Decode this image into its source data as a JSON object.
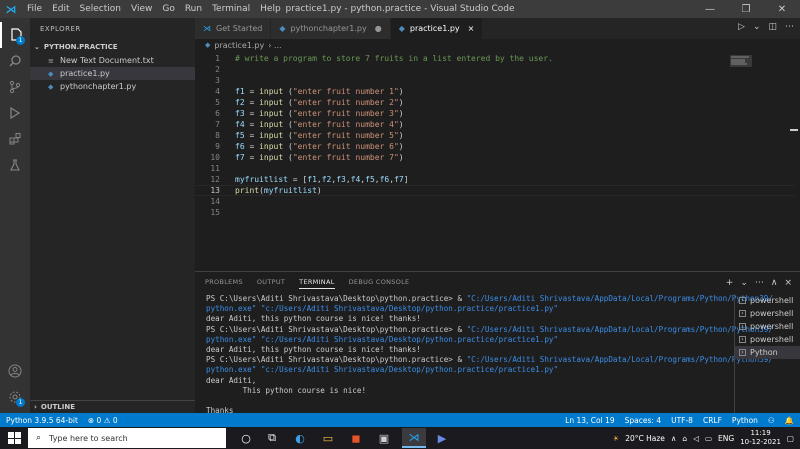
{
  "window": {
    "title": "practice1.py - python.practice - Visual Studio Code",
    "menu": [
      "File",
      "Edit",
      "Selection",
      "View",
      "Go",
      "Run",
      "Terminal",
      "Help"
    ]
  },
  "activity_bar": {
    "explorer_badge": "1",
    "accounts_badge": "1"
  },
  "sidebar": {
    "header": "EXPLORER",
    "folder": "PYTHON.PRACTICE",
    "files": [
      "New Text Document.txt",
      "practice1.py",
      "pythonchapter1.py"
    ],
    "outline": "OUTLINE"
  },
  "tabs": [
    {
      "label": "Get Started"
    },
    {
      "label": "pythonchapter1.py",
      "marker": "●"
    },
    {
      "label": "practice1.py",
      "marker": "×"
    }
  ],
  "breadcrumb": {
    "file": "practice1.py",
    "rest": "› ..."
  },
  "editor": {
    "current_line": 13,
    "lines": [
      [
        {
          "t": "# write a program to store 7 fruits in a list entered by the user.",
          "c": "comment"
        }
      ],
      [],
      [],
      [
        {
          "t": "f1",
          "c": "var"
        },
        {
          "t": " = ",
          "c": "op"
        },
        {
          "t": "input",
          "c": "fn"
        },
        {
          "t": " (",
          "c": "op"
        },
        {
          "t": "\"enter fruit number 1\"",
          "c": "str"
        },
        {
          "t": ")",
          "c": "op"
        }
      ],
      [
        {
          "t": "f2",
          "c": "var"
        },
        {
          "t": " = ",
          "c": "op"
        },
        {
          "t": "input",
          "c": "fn"
        },
        {
          "t": " (",
          "c": "op"
        },
        {
          "t": "\"enter fruit number 2\"",
          "c": "str"
        },
        {
          "t": ")",
          "c": "op"
        }
      ],
      [
        {
          "t": "f3",
          "c": "var"
        },
        {
          "t": " = ",
          "c": "op"
        },
        {
          "t": "input",
          "c": "fn"
        },
        {
          "t": " (",
          "c": "op"
        },
        {
          "t": "\"enter fruit number 3\"",
          "c": "str"
        },
        {
          "t": ")",
          "c": "op"
        }
      ],
      [
        {
          "t": "f4",
          "c": "var"
        },
        {
          "t": " = ",
          "c": "op"
        },
        {
          "t": "input",
          "c": "fn"
        },
        {
          "t": " (",
          "c": "op"
        },
        {
          "t": "\"enter fruit number 4\"",
          "c": "str"
        },
        {
          "t": ")",
          "c": "op"
        }
      ],
      [
        {
          "t": "f5",
          "c": "var"
        },
        {
          "t": " = ",
          "c": "op"
        },
        {
          "t": "input",
          "c": "fn"
        },
        {
          "t": " (",
          "c": "op"
        },
        {
          "t": "\"enter fruit number 5\"",
          "c": "str"
        },
        {
          "t": ")",
          "c": "op"
        }
      ],
      [
        {
          "t": "f6",
          "c": "var"
        },
        {
          "t": " = ",
          "c": "op"
        },
        {
          "t": "input",
          "c": "fn"
        },
        {
          "t": " (",
          "c": "op"
        },
        {
          "t": "\"enter fruit number 6\"",
          "c": "str"
        },
        {
          "t": ")",
          "c": "op"
        }
      ],
      [
        {
          "t": "f7",
          "c": "var"
        },
        {
          "t": " = ",
          "c": "op"
        },
        {
          "t": "input",
          "c": "fn"
        },
        {
          "t": " (",
          "c": "op"
        },
        {
          "t": "\"enter fruit number 7\"",
          "c": "str"
        },
        {
          "t": ")",
          "c": "op"
        }
      ],
      [],
      [
        {
          "t": "myfruitlist",
          "c": "var"
        },
        {
          "t": " = [",
          "c": "op"
        },
        {
          "t": "f1",
          "c": "var"
        },
        {
          "t": ",",
          "c": "op"
        },
        {
          "t": "f2",
          "c": "var"
        },
        {
          "t": ",",
          "c": "op"
        },
        {
          "t": "f3",
          "c": "var"
        },
        {
          "t": ",",
          "c": "op"
        },
        {
          "t": "f4",
          "c": "var"
        },
        {
          "t": ",",
          "c": "op"
        },
        {
          "t": "f5",
          "c": "var"
        },
        {
          "t": ",",
          "c": "op"
        },
        {
          "t": "f6",
          "c": "var"
        },
        {
          "t": ",",
          "c": "op"
        },
        {
          "t": "f7",
          "c": "var"
        },
        {
          "t": "]",
          "c": "op"
        }
      ],
      [
        {
          "t": "print",
          "c": "fn"
        },
        {
          "t": "(",
          "c": "op"
        },
        {
          "t": "myfruitlist",
          "c": "var"
        },
        {
          "t": ")",
          "c": "op"
        }
      ],
      [],
      []
    ]
  },
  "panel": {
    "tabs": [
      "PROBLEMS",
      "OUTPUT",
      "TERMINAL",
      "DEBUG CONSOLE"
    ],
    "active_tab": "TERMINAL",
    "tools": [
      "+",
      "⌄",
      "⋯",
      "∧",
      "×"
    ],
    "terminal_lines": [
      [
        {
          "t": "PS C:\\Users\\Aditi Shrivastava\\Desktop\\python.practice> & ",
          "c": ""
        },
        {
          "t": "\"C:/Users/Aditi Shrivastava/AppData/Local/Programs/Python/Python39/",
          "c": "path"
        }
      ],
      [
        {
          "t": "python.exe\" \"c:/Users/Aditi Shrivastava/Desktop/python.practice/practice1.py\"",
          "c": "path"
        }
      ],
      [
        {
          "t": "dear Aditi, this python course is nice! thanks!",
          "c": ""
        }
      ],
      [
        {
          "t": "PS C:\\Users\\Aditi Shrivastava\\Desktop\\python.practice> & ",
          "c": ""
        },
        {
          "t": "\"C:/Users/Aditi Shrivastava/AppData/Local/Programs/Python/Python39/",
          "c": "path"
        }
      ],
      [
        {
          "t": "python.exe\" \"c:/Users/Aditi Shrivastava/Desktop/python.practice/practice1.py\"",
          "c": "path"
        }
      ],
      [
        {
          "t": "dear Aditi, this python course is nice! thanks!",
          "c": ""
        }
      ],
      [
        {
          "t": "PS C:\\Users\\Aditi Shrivastava\\Desktop\\python.practice> & ",
          "c": ""
        },
        {
          "t": "\"C:/Users/Aditi Shrivastava/AppData/Local/Programs/Python/Python39/",
          "c": "path"
        }
      ],
      [
        {
          "t": "python.exe\" \"c:/Users/Aditi Shrivastava/Desktop/python.practice/practice1.py\"",
          "c": "path"
        }
      ],
      [
        {
          "t": "dear Aditi,",
          "c": ""
        }
      ],
      [
        {
          "t": "        This python course is nice!",
          "c": ""
        }
      ],
      [],
      [
        {
          "t": "Thanks",
          "c": ""
        }
      ],
      [
        {
          "t": "PS C:\\Users\\Aditi Shrivastava\\Desktop\\python.practice> & ",
          "c": ""
        },
        {
          "t": "\"C:/Users/Aditi Shrivastava/AppData/Local/Programs/Python/Python39/",
          "c": "path"
        }
      ],
      [
        {
          "t": "python.exe\" \"c:/Users/Aditi Shrivastava/Desktop/python.practice/practice1.py\"",
          "c": "path"
        }
      ],
      [
        {
          "t": "enter fruit number 1",
          "c": ""
        }
      ]
    ],
    "terminals": [
      "powershell",
      "powershell",
      "powershell",
      "powershell",
      "Python"
    ],
    "active_terminal": 4
  },
  "statusbar": {
    "left": [
      "Python 3.9.5 64-bit",
      "⊗ 0 ⚠ 0"
    ],
    "right": [
      "Ln 13, Col 19",
      "Spaces: 4",
      "UTF-8",
      "CRLF",
      "Python",
      "⚇",
      "🔔"
    ]
  },
  "taskbar": {
    "search_placeholder": "Type here to search",
    "weather": "20°C  Haze",
    "lang": "ENG",
    "time": "11:19",
    "date": "10-12-2021"
  },
  "colors": {
    "accent": "#007acc",
    "comment": "#6a9955",
    "string": "#ce9178",
    "function": "#dcdcaa",
    "variable": "#9cdcfe",
    "terminal_path": "#3b8eea"
  }
}
